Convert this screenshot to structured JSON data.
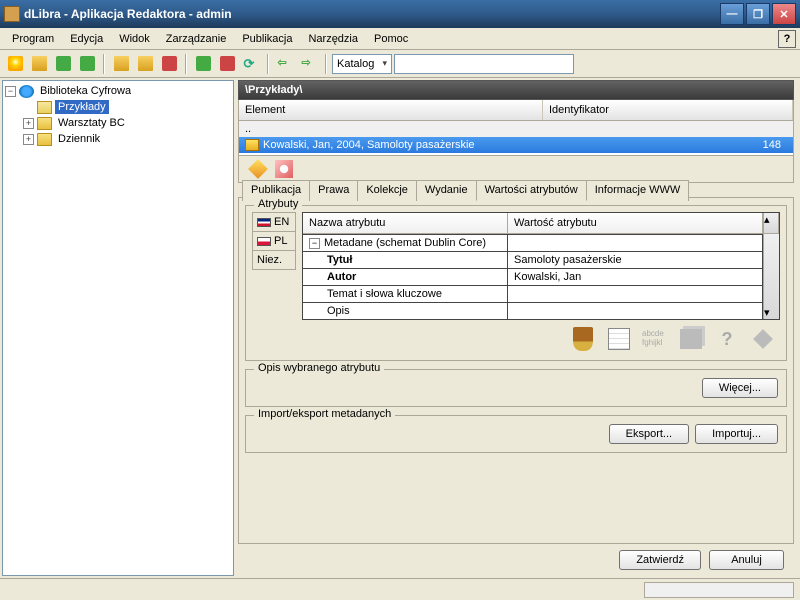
{
  "window": {
    "title": "dLibra - Aplikacja Redaktora - admin"
  },
  "menu": {
    "program": "Program",
    "edycja": "Edycja",
    "widok": "Widok",
    "zarzadzanie": "Zarządzanie",
    "publikacja": "Publikacja",
    "narzedzia": "Narzędzia",
    "pomoc": "Pomoc"
  },
  "toolbar": {
    "catalog": "Katalog"
  },
  "tree": {
    "root": "Biblioteka Cyfrowa",
    "items": [
      "Przykłady",
      "Warsztaty BC",
      "Dziennik"
    ]
  },
  "path": "\\Przykłady\\",
  "list": {
    "col_element": "Element",
    "col_id": "Identyfikator",
    "dots": "..",
    "row1": "Kowalski, Jan, 2004, Samoloty pasażerskie",
    "row1_id": "148"
  },
  "tabs": {
    "publikacja": "Publikacja",
    "prawa": "Prawa",
    "kolekcje": "Kolekcje",
    "wydanie": "Wydanie",
    "atrybuty": "Wartości atrybutów",
    "www": "Informacje WWW"
  },
  "attr": {
    "legend": "Atrybuty",
    "lang_en": "EN",
    "lang_pl": "PL",
    "lang_niez": "Niez.",
    "col_name": "Nazwa atrybutu",
    "col_value": "Wartość atrybutu",
    "group": "Metadane (schemat Dublin Core)",
    "tytul": "Tytuł",
    "tytul_v": "Samoloty pasażerskie",
    "autor": "Autor",
    "autor_v": "Kowalski, Jan",
    "temat": "Temat i słowa kluczowe",
    "opis": "Opis",
    "txticon": "abcde\nfghijkl"
  },
  "desc_legend": "Opis wybranego atrybutu",
  "import_legend": "Import/eksport metadanych",
  "buttons": {
    "wiecej": "Więcej...",
    "eksport": "Eksport...",
    "importuj": "Importuj...",
    "zatwierdz": "Zatwierdź",
    "anuluj": "Anuluj"
  }
}
